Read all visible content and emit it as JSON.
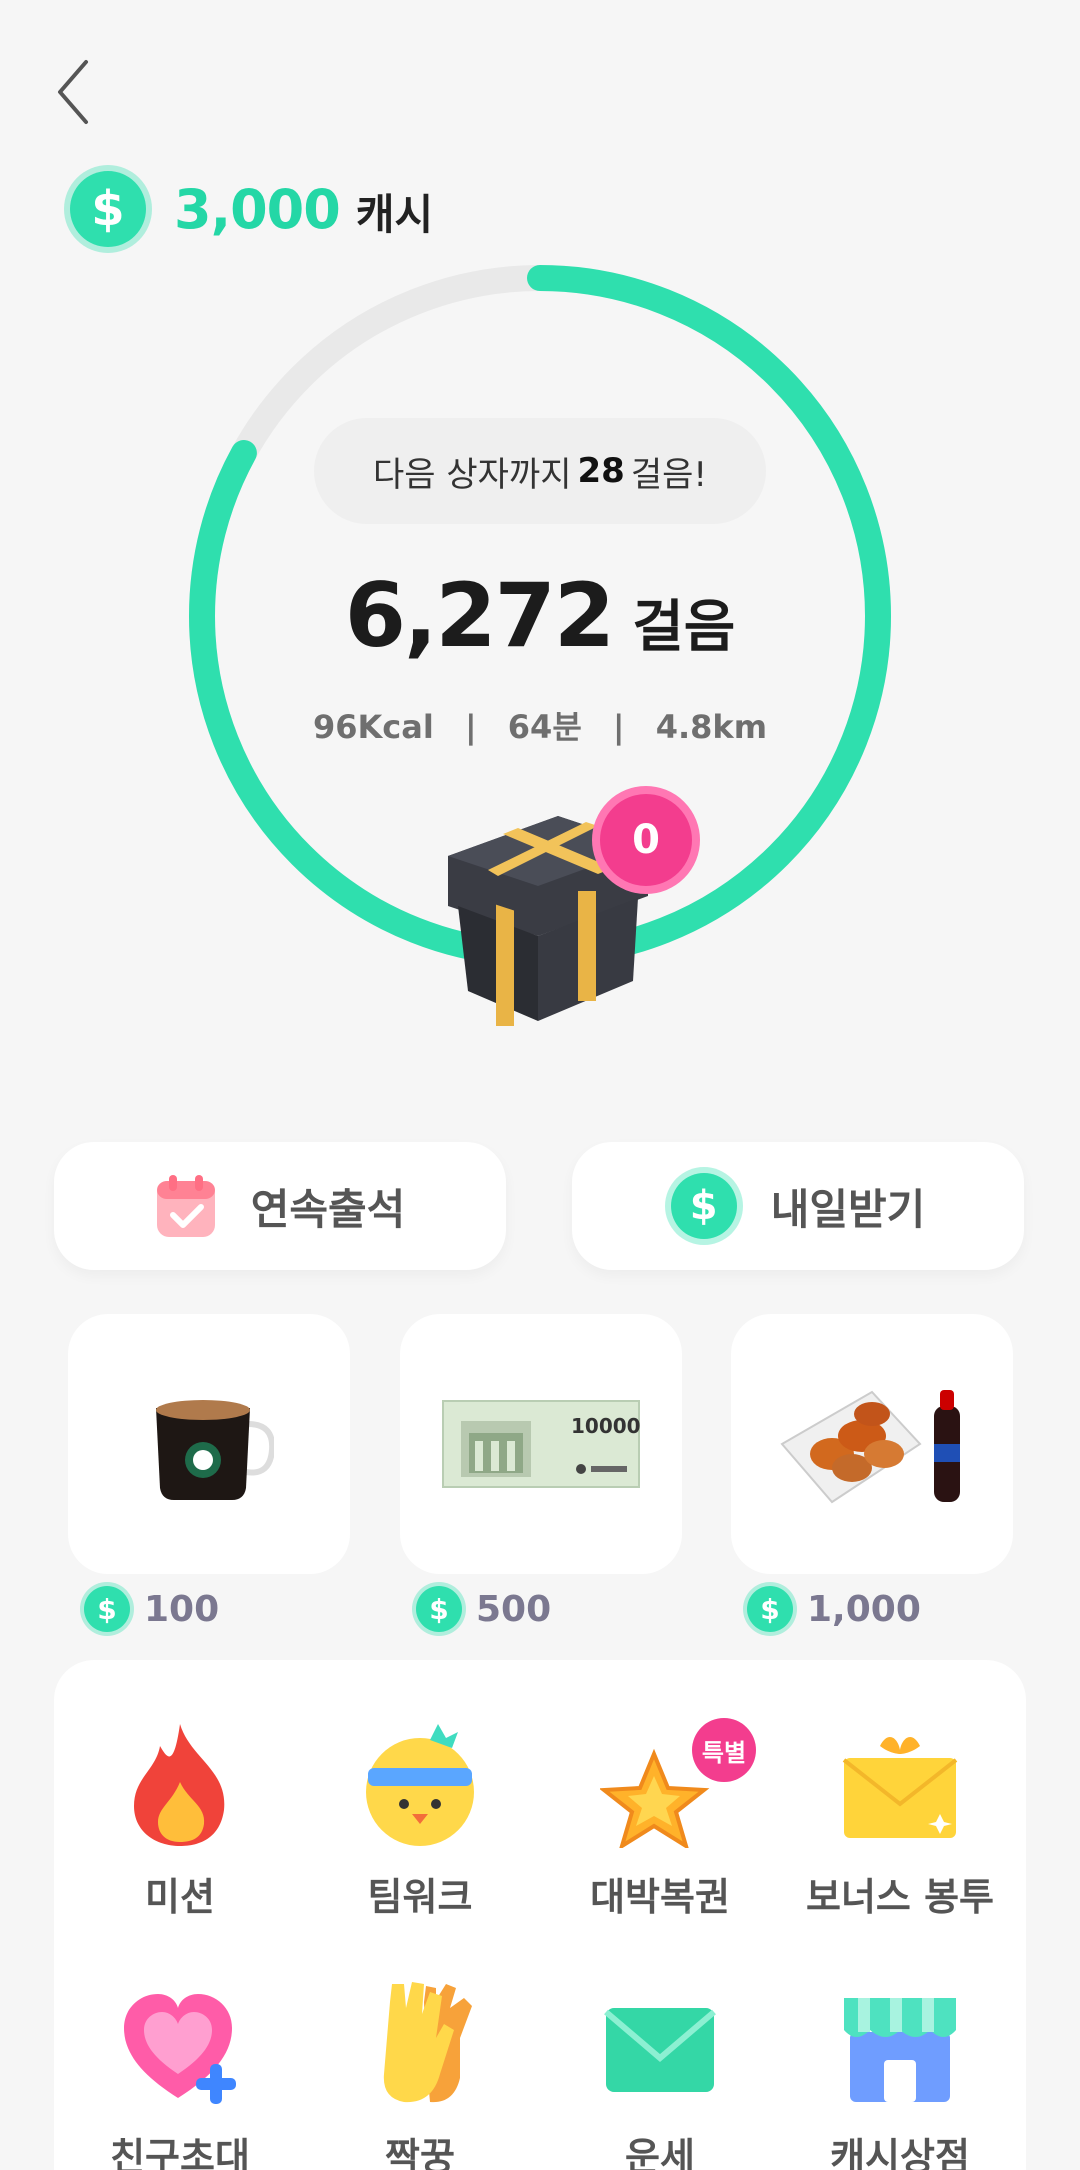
{
  "balance": {
    "amount": "3,000",
    "unit": "캐시",
    "currency_icon": "$"
  },
  "progress": {
    "next_box_prefix": "다음 상자까지",
    "next_box_steps": "28",
    "next_box_suffix": "걸음!",
    "steps": "6,272",
    "steps_unit": "걸음",
    "kcal": "96Kcal",
    "minutes": "64분",
    "distance": "4.8km",
    "separator": "|",
    "ring_fraction": 0.83,
    "box_count": "0"
  },
  "actions": {
    "attendance_label": "연속출석",
    "tomorrow_label": "내일받기"
  },
  "rewards": [
    {
      "name": "coffee",
      "price": "100"
    },
    {
      "name": "gift-certificate",
      "price": "500"
    },
    {
      "name": "chicken-set",
      "price": "1,000"
    }
  ],
  "voucher_text": "10000",
  "menu": [
    {
      "label": "미션",
      "icon": "fire-icon"
    },
    {
      "label": "팀워크",
      "icon": "chick-headband-icon"
    },
    {
      "label": "대박복권",
      "icon": "star-icon",
      "badge": "특별"
    },
    {
      "label": "보너스 봉투",
      "icon": "envelope-gift-icon"
    },
    {
      "label": "친구초대",
      "icon": "heart-plus-icon"
    },
    {
      "label": "짝꿍",
      "icon": "gloves-icon"
    },
    {
      "label": "운세",
      "icon": "mail-icon"
    },
    {
      "label": "캐시상점",
      "icon": "store-icon"
    }
  ],
  "colors": {
    "accent": "#2fdfae",
    "badge": "#f33d8e",
    "ring_track": "#e9e9e9"
  }
}
